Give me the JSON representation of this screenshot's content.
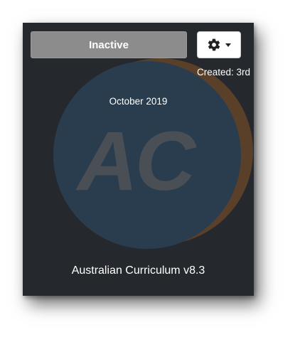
{
  "card": {
    "status_label": "Inactive",
    "created_prefix": "Created: 3rd",
    "created_suffix": "October 2019",
    "title": "Australian Curriculum v8.3",
    "settings_icon": "gear-icon",
    "dropdown_icon": "caret-down-icon",
    "logo": {
      "text": "AC",
      "circle_color": "#2a3d4e",
      "crescent_color": "#5a4029",
      "letter_color": "#4a4f55"
    }
  },
  "colors": {
    "card_background": "#25292d",
    "status_button": "#8c8c8c",
    "text": "#ffffff"
  }
}
